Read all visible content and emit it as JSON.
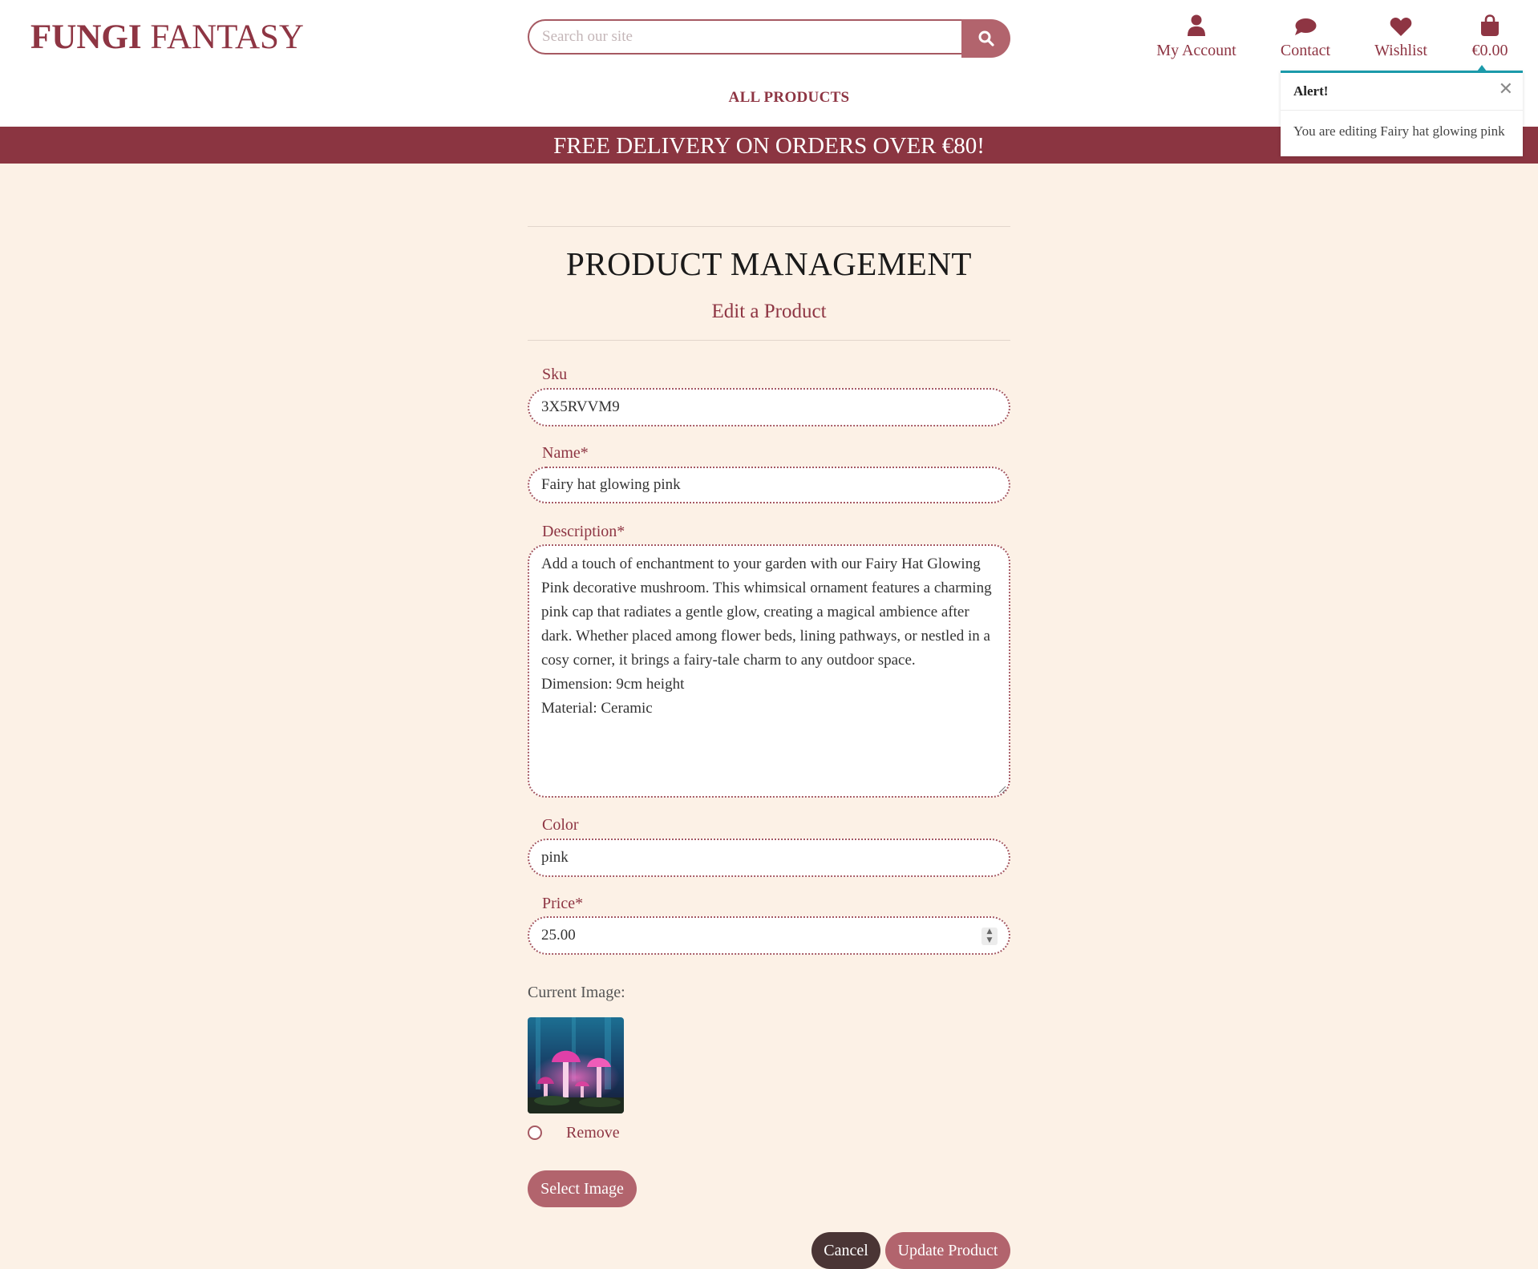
{
  "brand": {
    "part1": "FUNGI",
    "part2": "FANTASY"
  },
  "search": {
    "placeholder": "Search our site"
  },
  "nav": {
    "account": "My Account",
    "contact": "Contact",
    "wishlist": "Wishlist",
    "bag_total": "€0.00"
  },
  "menu": {
    "all_products": "ALL PRODUCTS"
  },
  "banner": "FREE DELIVERY ON ORDERS OVER €80!",
  "alert": {
    "title": "Alert!",
    "message": "You are editing Fairy hat glowing pink"
  },
  "page": {
    "title": "PRODUCT MANAGEMENT",
    "subtitle": "Edit a Product"
  },
  "form": {
    "sku_label": "Sku",
    "sku_value": "3X5RVVM9",
    "name_label": "Name*",
    "name_value": "Fairy hat glowing pink",
    "description_label": "Description*",
    "description_value": "Add a touch of enchantment to your garden with our Fairy Hat Glowing Pink decorative mushroom. This whimsical ornament features a charming pink cap that radiates a gentle glow, creating a magical ambience after dark. Whether placed among flower beds, lining pathways, or nestled in a cosy corner, it brings a fairy-tale charm to any outdoor space.\nDimension: 9cm height\nMaterial: Ceramic",
    "color_label": "Color",
    "color_value": "pink",
    "price_label": "Price*",
    "price_value": "25.00",
    "current_image_label": "Current Image:",
    "remove_label": "Remove",
    "select_image_label": "Select Image",
    "cancel_label": "Cancel",
    "update_label": "Update Product"
  },
  "colors": {
    "brand": "#8e3543",
    "banner": "#8b3541",
    "accent": "#b2646d",
    "page_bg": "#fcf1e6",
    "alert_border": "#1b9aaa",
    "cancel_btn": "#4a3535"
  },
  "icons": {
    "search": "search-icon",
    "account": "user-icon",
    "contact": "chat-bubble-icon",
    "wishlist": "heart-icon",
    "bag": "shopping-bag-icon",
    "close": "close-icon"
  }
}
